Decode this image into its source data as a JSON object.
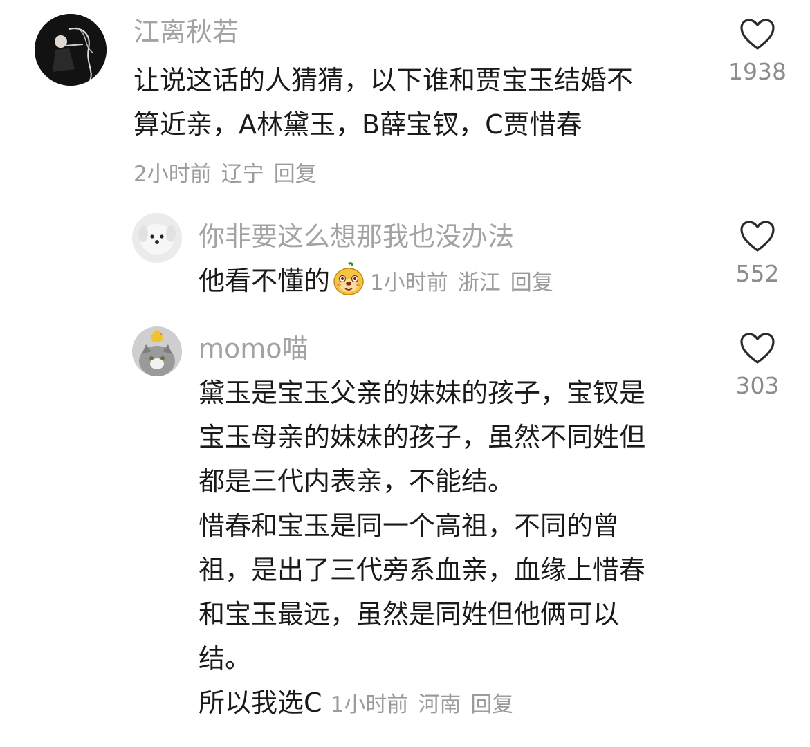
{
  "comments": [
    {
      "author": "江离秋若",
      "text": "让说这话的人猜猜，以下谁和贾宝玉结婚不\n算近亲，A林黛玉，B薛宝钗，C贾惜春",
      "time": "2小时前",
      "location": "辽宁",
      "reply_label": "回复",
      "likes": "1938"
    },
    {
      "author": "你非要这么想那我也没办法",
      "text": "他看不懂的",
      "emoji": "doge-emoji",
      "time": "1小时前",
      "location": "浙江",
      "reply_label": "回复",
      "likes": "552"
    },
    {
      "author": "momo喵",
      "lines": [
        "黛玉是宝玉父亲的妹妹的孩子，宝钗是",
        "宝玉母亲的妹妹的孩子，虽然不同姓但",
        "都是三代内表亲，不能结。",
        "惜春和宝玉是同一个高祖，不同的曾",
        "祖，是出了三代旁系血亲，血缘上惜春",
        "和宝玉最远，虽然是同姓但他俩可以",
        "结。"
      ],
      "last_line": "所以我选C",
      "time": "1小时前",
      "location": "河南",
      "reply_label": "回复",
      "likes": "303"
    }
  ],
  "colors": {
    "name": "#a3a3a3",
    "meta": "#9b9b9b",
    "text": "#1a1a1a",
    "count": "#8c8c8c"
  }
}
